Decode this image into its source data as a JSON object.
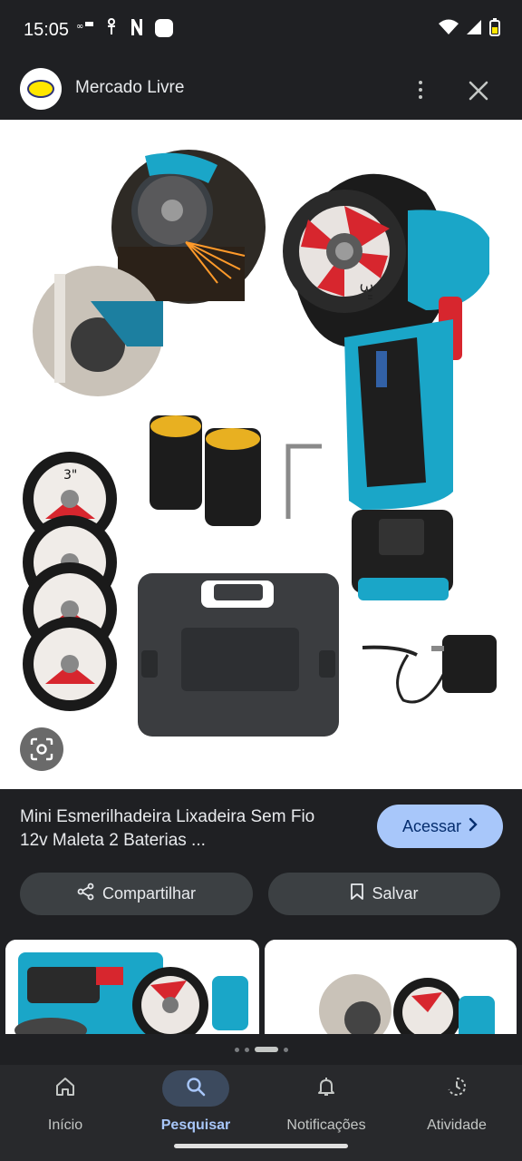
{
  "status_bar": {
    "time": "15:05",
    "notification_icons": [
      "app-notification-icon",
      "accessibility-icon",
      "netflix-icon",
      "chat-icon"
    ],
    "right_icons": [
      "wifi-icon",
      "cellular-signal-icon",
      "battery-icon"
    ]
  },
  "header": {
    "site_name": "Mercado Livre",
    "logo_icon": "mercado-livre-logo",
    "more_icon": "more-vert-icon",
    "close_icon": "close-icon"
  },
  "image": {
    "thumbnail_labels": [
      "3\"",
      "3\""
    ],
    "lens_icon": "google-lens-icon"
  },
  "product": {
    "title_line1": "Mini Esmerilhadeira Lixadeira Sem Fio",
    "title_line2": "12v Maleta 2 Baterias ...",
    "access_label": "Acessar",
    "share_label": "Compartilhar",
    "save_label": "Salvar"
  },
  "pager": {
    "count": 4,
    "active_index": 2
  },
  "bottom_nav": {
    "items": [
      {
        "label": "Início",
        "icon": "home-icon"
      },
      {
        "label": "Pesquisar",
        "icon": "search-icon"
      },
      {
        "label": "Notificações",
        "icon": "bell-icon"
      },
      {
        "label": "Atividade",
        "icon": "activity-icon"
      }
    ],
    "active_index": 1
  },
  "colors": {
    "background": "#1f2023",
    "accent": "#a8c7fa",
    "pill": "#3c4043",
    "tool_teal": "#1aa6c8"
  }
}
